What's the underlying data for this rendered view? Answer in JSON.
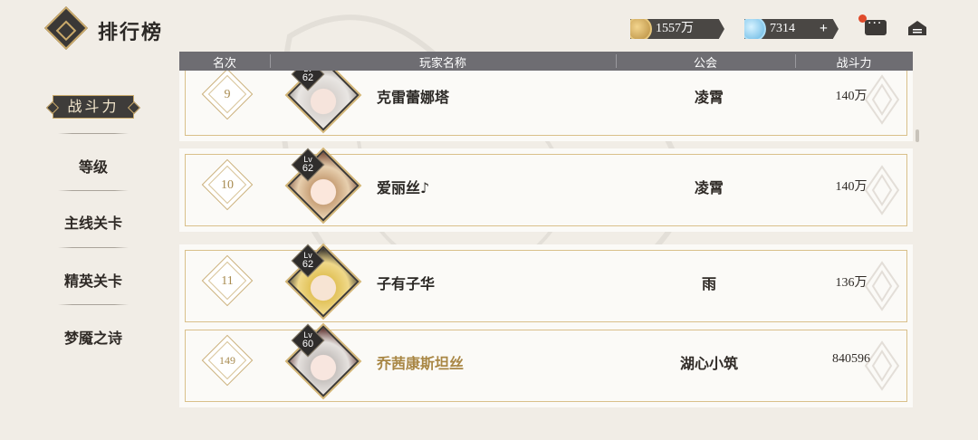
{
  "header": {
    "title": "排行榜",
    "gold": "1557万",
    "gems": "7314",
    "plus": "+"
  },
  "nav": {
    "active": "战斗力",
    "items": [
      "等级",
      "主线关卡",
      "精英关卡",
      "梦魇之诗"
    ]
  },
  "table": {
    "columns": [
      "名次",
      "玩家名称",
      "公会",
      "战斗力"
    ],
    "rows": [
      {
        "rank": "9",
        "level": "62",
        "name": "克雷蕾娜塔",
        "guild": "凌霄",
        "power": "140万"
      },
      {
        "rank": "10",
        "level": "62",
        "name": "爱丽丝♪",
        "guild": "凌霄",
        "power": "140万"
      },
      {
        "rank": "11",
        "level": "62",
        "name": "子有子华",
        "guild": "雨",
        "power": "136万"
      },
      {
        "rank": "149",
        "level": "60",
        "name": "乔茜康斯坦丝",
        "guild": "湖心小筑",
        "power": "840596",
        "self": true
      }
    ],
    "lv_prefix": "Lv"
  },
  "colors": {
    "accent_gold": "#c9a96a",
    "header_bar": "#6e6d72",
    "self_name": "#a98745"
  },
  "icons": [
    "logo-icon",
    "gold-coin-icon",
    "gem-icon",
    "chat-icon",
    "home-icon"
  ]
}
